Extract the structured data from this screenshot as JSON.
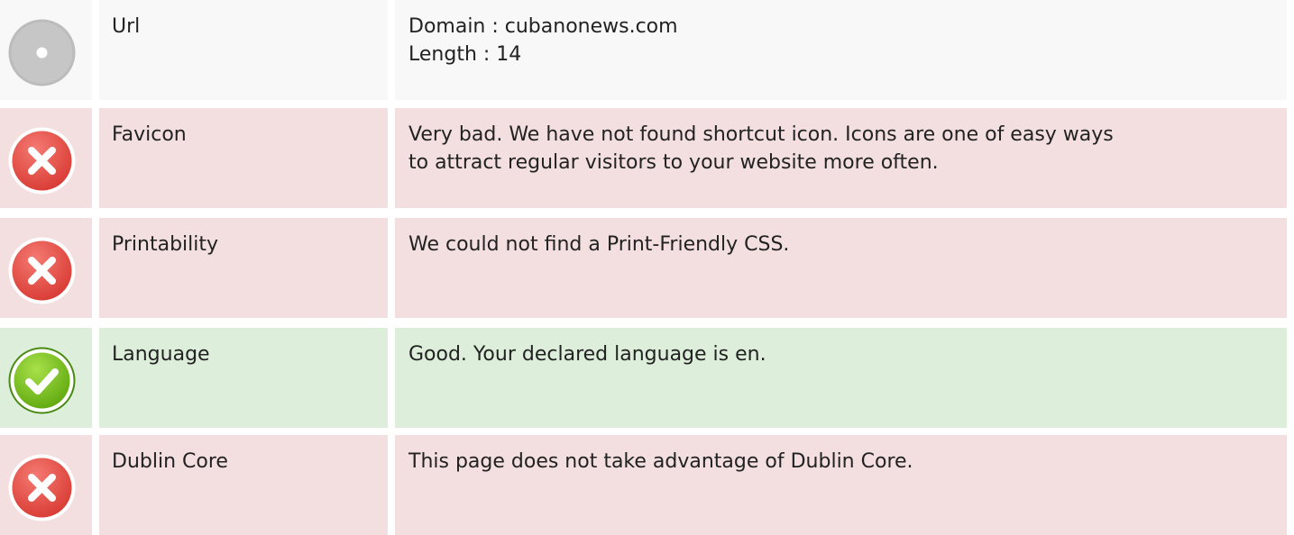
{
  "rows": [
    {
      "status": "neutral",
      "icon": "neutral-circle-icon",
      "label": "Url",
      "lines": [
        "Domain : cubanonews.com",
        "Length : 14"
      ]
    },
    {
      "status": "bad",
      "icon": "error-x-icon",
      "label": "Favicon",
      "lines": [
        "Very bad. We have not found shortcut icon. Icons are one of easy ways",
        "to attract regular visitors to your website more often."
      ]
    },
    {
      "status": "bad",
      "icon": "error-x-icon",
      "label": "Printability",
      "lines": [
        "We could not find a Print-Friendly CSS."
      ]
    },
    {
      "status": "good",
      "icon": "check-icon",
      "label": "Language",
      "lines": [
        "Good. Your declared language is en."
      ]
    },
    {
      "status": "bad",
      "icon": "error-x-icon",
      "label": "Dublin Core",
      "lines": [
        "This page does not take advantage of Dublin Core."
      ]
    }
  ],
  "colors": {
    "neutral_bg": "#f8f8f8",
    "bad_bg": "#f3dfe0",
    "good_bg": "#ddefda",
    "error_red": "#e0443c",
    "success_green": "#7cc420",
    "neutral_gray": "#bdbdbd"
  }
}
